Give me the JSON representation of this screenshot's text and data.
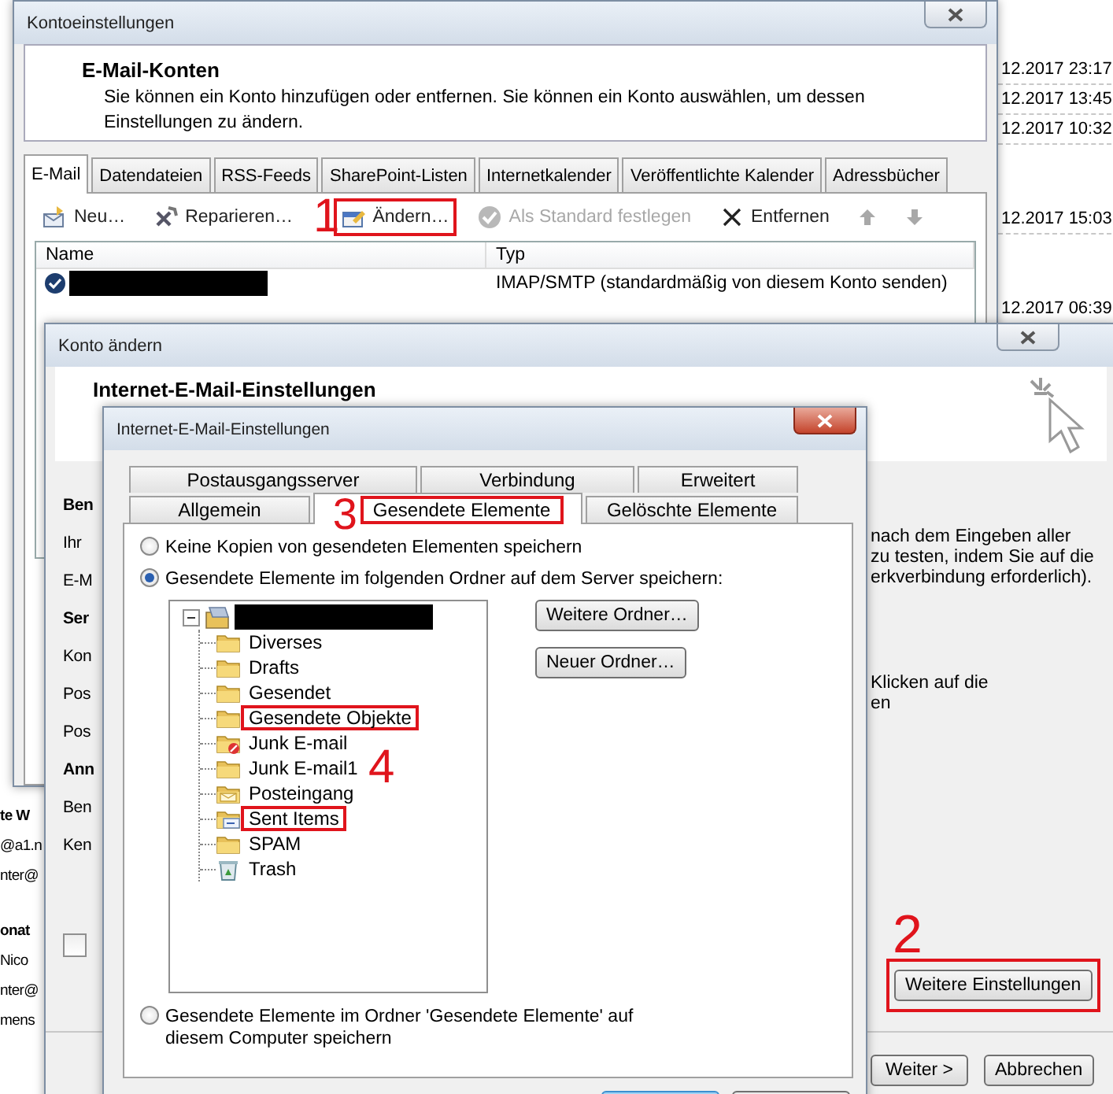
{
  "desktop": {
    "time_groups": [
      [
        "12.2017 23:17",
        "12.2017 13:45",
        "12.2017 10:32"
      ],
      [
        "12.2017 15:03"
      ],
      [
        "12.2017 06:39"
      ]
    ],
    "fragment_groups": [
      [
        {
          "text": "te W",
          "bold": true
        },
        {
          "text": "@a1.n",
          "bold": false
        },
        {
          "text": "nter@",
          "bold": false
        }
      ],
      [
        {
          "text": "onat",
          "bold": true
        },
        {
          "text": "Nico",
          "bold": false
        },
        {
          "text": "nter@",
          "bold": false
        },
        {
          "text": "mens",
          "bold": false
        }
      ]
    ]
  },
  "account_settings": {
    "title": "Kontoeinstellungen",
    "heading": "E-Mail-Konten",
    "description": "Sie können ein Konto hinzufügen oder entfernen. Sie können ein Konto auswählen, um dessen Einstellungen zu ändern.",
    "tabs": [
      {
        "label": "E-Mail",
        "selected": true
      },
      {
        "label": "Datendateien",
        "selected": false
      },
      {
        "label": "RSS-Feeds",
        "selected": false
      },
      {
        "label": "SharePoint-Listen",
        "selected": false
      },
      {
        "label": "Internetkalender",
        "selected": false
      },
      {
        "label": "Veröffentlichte Kalender",
        "selected": false
      },
      {
        "label": "Adressbücher",
        "selected": false
      }
    ],
    "toolbar": [
      {
        "kind": "new",
        "label": "Neu…",
        "disabled": false,
        "highlighted": false
      },
      {
        "kind": "repair",
        "label": "Reparieren…",
        "disabled": false,
        "highlighted": false
      },
      {
        "kind": "change",
        "label": "Ändern…",
        "disabled": false,
        "highlighted": true,
        "marker": "1"
      },
      {
        "kind": "default",
        "label": "Als Standard festlegen",
        "disabled": true,
        "highlighted": false
      },
      {
        "kind": "remove",
        "label": "Entfernen",
        "disabled": false,
        "highlighted": false
      },
      {
        "kind": "up",
        "disabled": true,
        "highlighted": false
      },
      {
        "kind": "down",
        "disabled": true,
        "highlighted": false
      }
    ],
    "columns": [
      "Name",
      "Typ"
    ],
    "rows": [
      {
        "type": "IMAP/SMTP (standardmäßig von diesem Konto senden)"
      }
    ]
  },
  "change_account": {
    "title": "Konto ändern",
    "heading": "Internet-E-Mail-Einstellungen",
    "left_fragments": [
      {
        "text": "Ben",
        "bold": true
      },
      {
        "text": "Ihr",
        "bold": false
      },
      {
        "text": "E-M",
        "bold": false
      },
      {
        "text": "Ser",
        "bold": true
      },
      {
        "text": "Kon",
        "bold": false
      },
      {
        "text": "Pos",
        "bold": false
      },
      {
        "text": "Pos",
        "bold": false
      },
      {
        "text": "Ann",
        "bold": true
      },
      {
        "text": "Ben",
        "bold": false
      },
      {
        "text": "Ken",
        "bold": false
      }
    ],
    "checkbox": {
      "checked": false
    },
    "right_fragments": [
      [
        "nach dem Eingeben aller",
        "zu testen, indem Sie auf die",
        "erkverbindung erforderlich)."
      ],
      [
        "Klicken auf die",
        "en"
      ]
    ],
    "more_settings": {
      "label": "Weitere Einstellungen",
      "highlighted": true,
      "marker": "2"
    },
    "buttons": [
      "Weiter >",
      "Abbrechen"
    ]
  },
  "email_settings": {
    "title": "Internet-E-Mail-Einstellungen",
    "tab_rows": [
      [
        {
          "label": "Postausgangsserver",
          "selected": false
        },
        {
          "label": "Verbindung",
          "selected": false
        },
        {
          "label": "Erweitert",
          "selected": false
        }
      ],
      [
        {
          "label": "Allgemein",
          "selected": false
        },
        {
          "label": "Gesendete Elemente",
          "selected": true,
          "highlighted": true,
          "marker": "3"
        },
        {
          "label": "Gelöschte Elemente",
          "selected": false
        }
      ]
    ],
    "options": [
      {
        "label": "Keine Kopien von gesendeten Elementen speichern",
        "selected": false
      },
      {
        "label": "Gesendete Elemente im folgenden Ordner auf dem Server speichern:",
        "selected": true
      },
      {
        "label": "Gesendete Elemente im Ordner 'Gesendete Elemente' auf diesem Computer speichern",
        "selected": false
      }
    ],
    "tree": {
      "expanded": true,
      "marker": "4",
      "children": [
        {
          "label": "Diverses",
          "kind": "folder",
          "highlighted": false
        },
        {
          "label": "Drafts",
          "kind": "folder",
          "highlighted": false
        },
        {
          "label": "Gesendet",
          "kind": "folder",
          "highlighted": false
        },
        {
          "label": "Gesendete Objekte",
          "kind": "folder",
          "highlighted": true
        },
        {
          "label": "Junk E-mail",
          "kind": "junk",
          "highlighted": false
        },
        {
          "label": "Junk E-mail1",
          "kind": "folder",
          "highlighted": false
        },
        {
          "label": "Posteingang",
          "kind": "inbox",
          "highlighted": false
        },
        {
          "label": "Sent Items",
          "kind": "sent",
          "highlighted": true
        },
        {
          "label": "SPAM",
          "kind": "folder",
          "highlighted": false
        },
        {
          "label": "Trash",
          "kind": "trash",
          "highlighted": false
        }
      ]
    },
    "folder_buttons": [
      "Weitere Ordner…",
      "Neuer Ordner…"
    ]
  }
}
